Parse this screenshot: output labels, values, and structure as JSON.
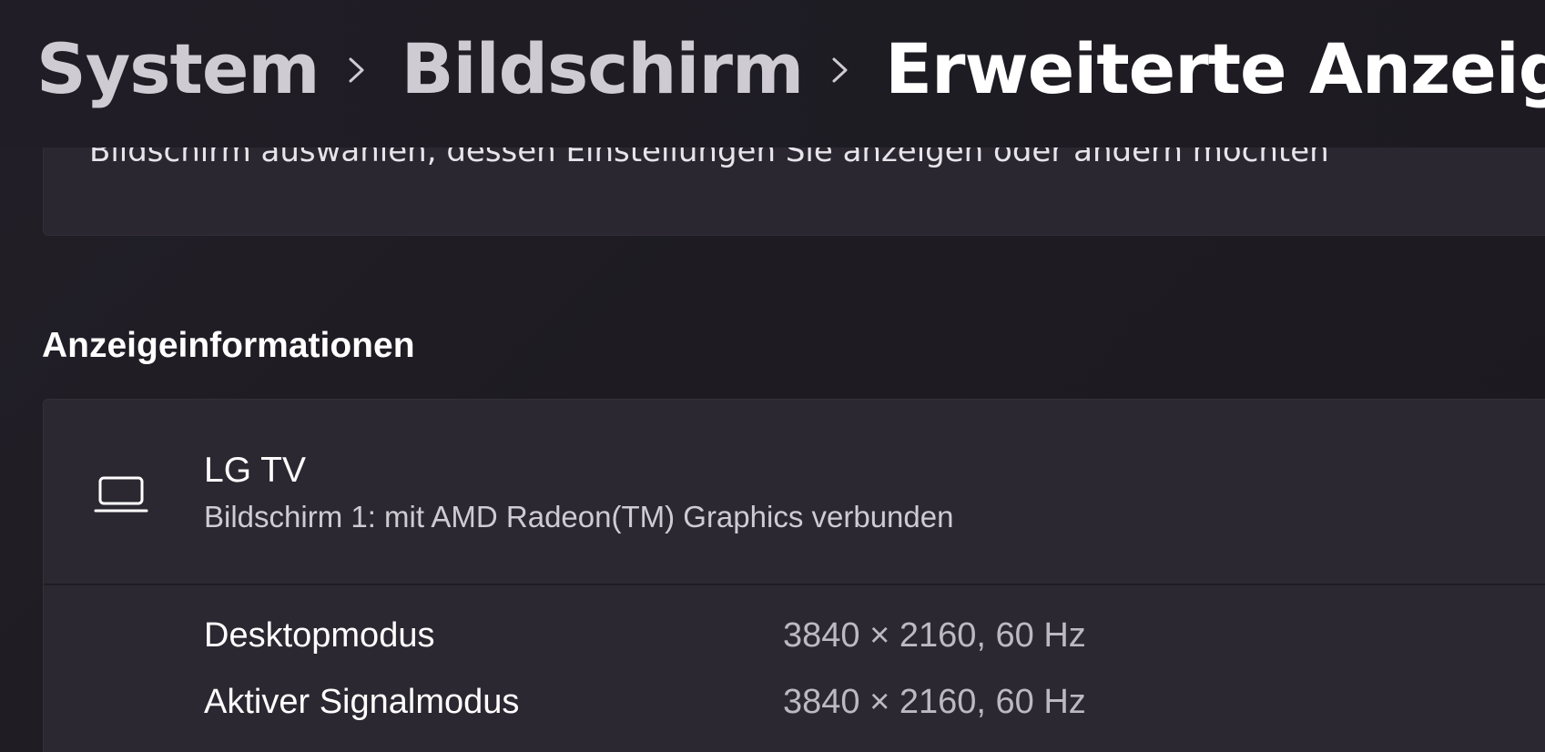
{
  "breadcrumb": {
    "items": [
      "System",
      "Bildschirm",
      "Erweiterte Anzeige"
    ]
  },
  "top_card": {
    "partial_text": "Bildschirm auswählen, dessen Einstellungen Sie anzeigen oder ändern möchten"
  },
  "section": {
    "title": "Anzeigeinformationen"
  },
  "display": {
    "icon": "laptop-icon",
    "name": "LG TV",
    "subtitle": "Bildschirm 1: mit AMD Radeon(TM) Graphics verbunden",
    "rows": [
      {
        "label": "Desktopmodus",
        "value": "3840 × 2160, 60 Hz"
      },
      {
        "label": "Aktiver Signalmodus",
        "value": "3840 × 2160, 60 Hz"
      }
    ]
  },
  "colors": {
    "background": "#1f1c24",
    "card": "#2b2831",
    "text_primary": "#ffffff",
    "text_secondary": "#bdb9c2",
    "breadcrumb_inactive": "#cfcbd2"
  }
}
